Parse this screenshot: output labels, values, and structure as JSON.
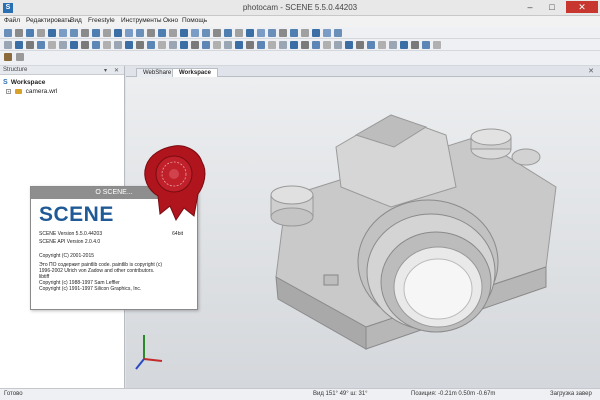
{
  "window": {
    "title": "photocam - SCENE 5.5.0.44203",
    "app_icon": "S",
    "min": "–",
    "max": "□",
    "close": "✕"
  },
  "menu": [
    {
      "label": "Файл"
    },
    {
      "label": "Редактировать"
    },
    {
      "label": "Вид"
    },
    {
      "label": "Freestyle"
    },
    {
      "label": "Инструменты"
    },
    {
      "label": "Окно"
    },
    {
      "label": "Помощь"
    }
  ],
  "structure_panel": {
    "title": "Structure",
    "pin": "▾",
    "close": "✕",
    "root_label": "Workspace",
    "root_icon": "S",
    "child_label": "camera.wrl",
    "expander": "+"
  },
  "tabs": [
    {
      "label": "WebShare"
    },
    {
      "label": "Workspace"
    }
  ],
  "tab_close": "✕",
  "about": {
    "title": "О SCENE...",
    "logo": "SCENE",
    "version": "SCENE Version 5.5.0.44203",
    "bitness": "64bit",
    "api_version": "SCENE API Version 2.0.4.0",
    "copyright": "Copyright (C) 2001-2015",
    "paintlib1": "Это ПО содержит paintlib code. paintlib is copyright (c)",
    "paintlib2": "1996-2002 Ulrich von Zadow and other contributors.",
    "libtiff": "libtiff",
    "sam": "Copyright (c) 1988-1997 Sam Leffler",
    "sgi": "Copyright (c) 1991-1997 Silicon Graphics, Inc."
  },
  "status": {
    "ready": "Готово",
    "view": "Вид 151° 49° ш: 31°",
    "position": "Позиция: -0.21m 0.50m -0.67m",
    "loading": "Загрузка завер"
  },
  "colors": {
    "accent": "#1f5a96",
    "close": "#c7372f",
    "seal": "#b0141c"
  },
  "icons": [
    "app-icon",
    "seal-icon",
    "axis-gizmo-icon",
    "camera-file-icon",
    "workspace-icon"
  ]
}
